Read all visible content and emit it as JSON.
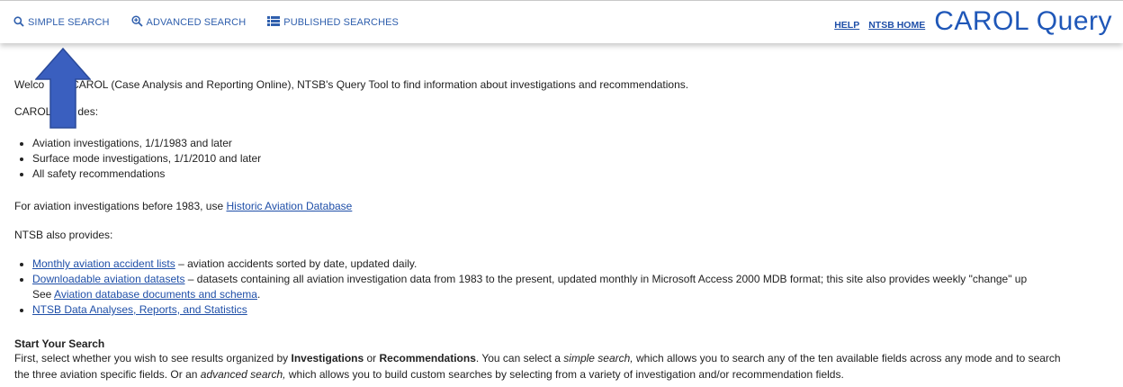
{
  "header": {
    "nav": [
      {
        "label": "SIMPLE SEARCH",
        "icon": "search-icon"
      },
      {
        "label": "ADVANCED SEARCH",
        "icon": "zoom-plus-icon"
      },
      {
        "label": "PUBLISHED SEARCHES",
        "icon": "list-icon"
      }
    ],
    "help_label": "HELP",
    "ntsb_home_label": "NTSB HOME",
    "brand": "CAROL Query"
  },
  "intro": {
    "welcome_pre": "Welco",
    "welcome_post": "CAROL (Case Analysis and Reporting Online), NTSB's Query Tool to find information about investigations and recommendations.",
    "includes_pre": "CAROL",
    "includes_post": "des:",
    "includes_items": [
      "Aviation investigations, 1/1/1983 and later",
      "Surface mode investigations, 1/1/2010 and later",
      "All safety recommendations"
    ],
    "historic_text": "For aviation investigations before 1983, use ",
    "historic_link": "Historic Aviation Database",
    "provides_label": "NTSB also provides:",
    "monthly_link": "Monthly aviation accident lists",
    "monthly_text": " – aviation accidents sorted by date, updated daily.",
    "downloadable_link": "Downloadable aviation datasets",
    "downloadable_text": " – datasets containing all aviation investigation data from 1983 to the present, updated monthly in Microsoft Access 2000 MDB format; this site also provides weekly \"change\" up",
    "see_text": "See ",
    "schema_link": "Aviation database documents and schema",
    "schema_end": ".",
    "analyses_link": "NTSB Data Analyses, Reports, and Statistics"
  },
  "start": {
    "heading": "Start Your Search",
    "line1_a": "First, select whether you wish to see results organized by ",
    "line1_b": "Investigations",
    "line1_c": " or ",
    "line1_d": "Recommendations",
    "line1_e": ". You can select a ",
    "line1_f": "simple search,",
    "line1_g": " which allows you to search any of the ten available fields across any mode and to search",
    "line2_a": "the three aviation specific fields. Or an ",
    "line2_b": "advanced search,",
    "line2_c": " which allows you to build custom searches by selecting from a variety of investigation and/or recommendation fields."
  },
  "colors": {
    "link": "#1f4fa8",
    "brand": "#1f57b8",
    "arrow_fill": "#3a5fbf",
    "arrow_stroke": "#2a4a9a"
  }
}
